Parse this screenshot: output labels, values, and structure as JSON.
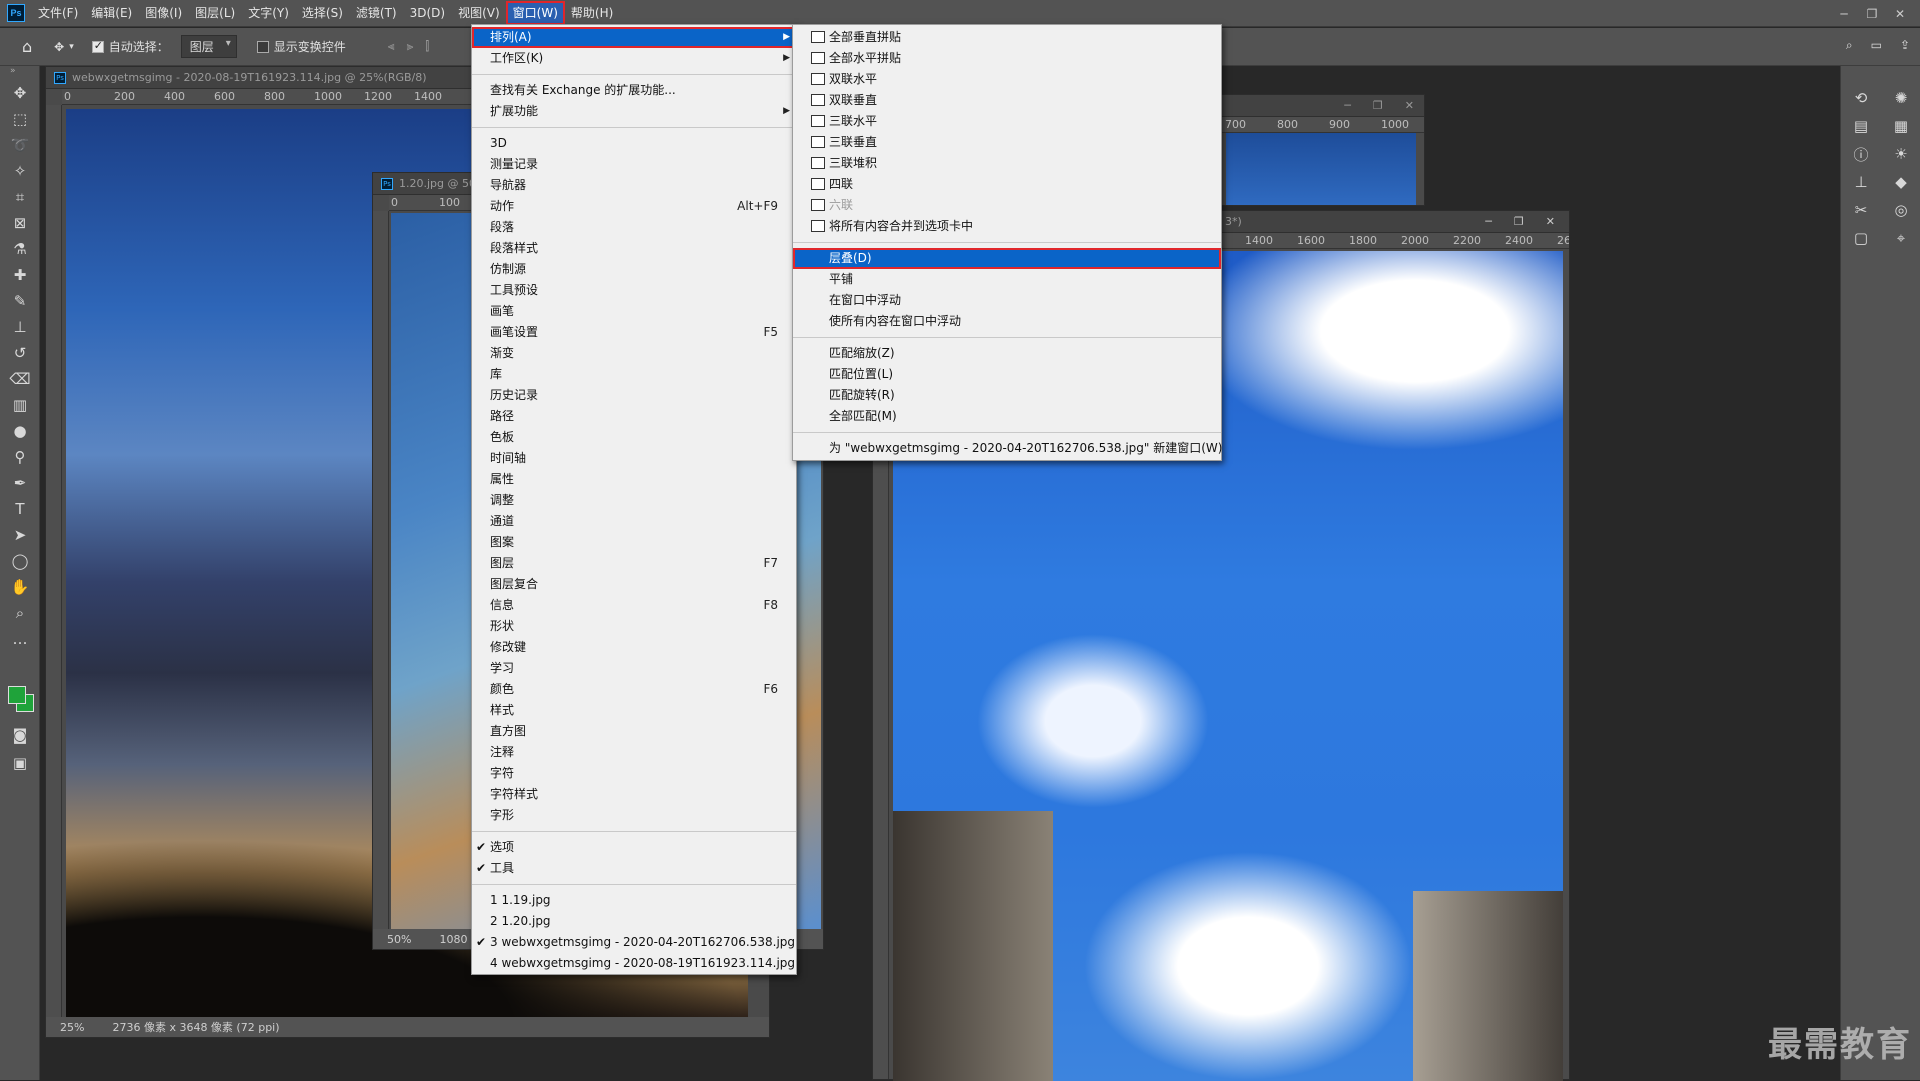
{
  "app": {
    "logo": "Ps"
  },
  "menubar": {
    "items": [
      "文件(F)",
      "编辑(E)",
      "图像(I)",
      "图层(L)",
      "文字(Y)",
      "选择(S)",
      "滤镜(T)",
      "3D(D)",
      "视图(V)",
      "窗口(W)",
      "帮助(H)"
    ],
    "active": "窗口(W)"
  },
  "window_controls": {
    "minimize": "─",
    "restore": "❐",
    "close": "✕"
  },
  "options_bar": {
    "auto_select_label": "自动选择：",
    "auto_select_checked": true,
    "layer_select_value": "图层",
    "show_transform_label": "显示变换控件",
    "show_transform_checked": false
  },
  "doc1": {
    "title": "webwxgetmsgimg - 2020-08-19T161923.114.jpg @ 25%(RGB/8)",
    "ruler_ticks": [
      "0",
      "200",
      "400",
      "600",
      "800",
      "1000",
      "1200",
      "1400"
    ],
    "zoom": "25%",
    "size_info": "2736 像素 x 3648 像素 (72 ppi)"
  },
  "doc2": {
    "title": "1.20.jpg @ 50",
    "ruler_ticks": [
      "0",
      "100"
    ],
    "zoom": "50%",
    "size_info": "1080 像"
  },
  "doc3": {
    "ruler_ticks": [
      "700",
      "800",
      "900",
      "1000"
    ]
  },
  "doc4": {
    "title_suffix": "3*)",
    "ruler_ticks": [
      "1400",
      "1600",
      "1800",
      "2000",
      "2200",
      "2400",
      "26"
    ]
  },
  "window_menu": {
    "items": [
      {
        "label": "排列(A)",
        "submenu": true,
        "highlighted": true
      },
      {
        "label": "工作区(K)",
        "submenu": true
      },
      {
        "sep": true
      },
      {
        "label": "查找有关 Exchange 的扩展功能..."
      },
      {
        "label": "扩展功能",
        "submenu": true
      },
      {
        "sep": true
      },
      {
        "label": "3D"
      },
      {
        "label": "测量记录"
      },
      {
        "label": "导航器"
      },
      {
        "label": "动作",
        "shortcut": "Alt+F9"
      },
      {
        "label": "段落"
      },
      {
        "label": "段落样式"
      },
      {
        "label": "仿制源"
      },
      {
        "label": "工具预设"
      },
      {
        "label": "画笔"
      },
      {
        "label": "画笔设置",
        "shortcut": "F5"
      },
      {
        "label": "渐变"
      },
      {
        "label": "库"
      },
      {
        "label": "历史记录"
      },
      {
        "label": "路径"
      },
      {
        "label": "色板"
      },
      {
        "label": "时间轴"
      },
      {
        "label": "属性"
      },
      {
        "label": "调整"
      },
      {
        "label": "通道"
      },
      {
        "label": "图案"
      },
      {
        "label": "图层",
        "shortcut": "F7"
      },
      {
        "label": "图层复合"
      },
      {
        "label": "信息",
        "shortcut": "F8"
      },
      {
        "label": "形状"
      },
      {
        "label": "修改键"
      },
      {
        "label": "学习"
      },
      {
        "label": "颜色",
        "shortcut": "F6"
      },
      {
        "label": "样式"
      },
      {
        "label": "直方图"
      },
      {
        "label": "注释"
      },
      {
        "label": "字符"
      },
      {
        "label": "字符样式"
      },
      {
        "label": "字形"
      },
      {
        "sep": true
      },
      {
        "label": "选项",
        "checked": true
      },
      {
        "label": "工具",
        "checked": true
      },
      {
        "sep": true
      },
      {
        "label": "1 1.19.jpg"
      },
      {
        "label": "2 1.20.jpg"
      },
      {
        "label": "3 webwxgetmsgimg - 2020-04-20T162706.538.jpg",
        "checked": true
      },
      {
        "label": "4 webwxgetmsgimg - 2020-08-19T161923.114.jpg"
      }
    ]
  },
  "arrange_menu": {
    "items": [
      {
        "label": "全部垂直拼贴",
        "icon": "tile-vertical-icon"
      },
      {
        "label": "全部水平拼贴",
        "icon": "tile-horizontal-icon"
      },
      {
        "label": "双联水平",
        "icon": "2up-horizontal-icon"
      },
      {
        "label": "双联垂直",
        "icon": "2up-vertical-icon"
      },
      {
        "label": "三联水平",
        "icon": "3up-horizontal-icon"
      },
      {
        "label": "三联垂直",
        "icon": "3up-vertical-icon"
      },
      {
        "label": "三联堆积",
        "icon": "3up-stacked-icon"
      },
      {
        "label": "四联",
        "icon": "4up-icon"
      },
      {
        "label": "六联",
        "icon": "6up-icon",
        "disabled": true
      },
      {
        "label": "将所有内容合并到选项卡中",
        "icon": "consolidate-tabs-icon"
      },
      {
        "sep": true
      },
      {
        "label": "层叠(D)",
        "highlighted": true
      },
      {
        "label": "平铺"
      },
      {
        "label": "在窗口中浮动"
      },
      {
        "label": "使所有内容在窗口中浮动"
      },
      {
        "sep": true
      },
      {
        "label": "匹配缩放(Z)"
      },
      {
        "label": "匹配位置(L)"
      },
      {
        "label": "匹配旋转(R)"
      },
      {
        "label": "全部匹配(M)"
      },
      {
        "sep": true
      },
      {
        "label": "为 \"webwxgetmsgimg - 2020-04-20T162706.538.jpg\" 新建窗口(W)"
      }
    ]
  },
  "tools": [
    "move-icon",
    "marquee-icon",
    "lasso-icon",
    "magic-wand-icon",
    "crop-icon",
    "frame-icon",
    "eyedropper-icon",
    "healing-icon",
    "brush-icon",
    "stamp-icon",
    "history-brush-icon",
    "eraser-icon",
    "gradient-icon",
    "blur-icon",
    "dodge-icon",
    "pen-icon",
    "type-icon",
    "path-select-icon",
    "ellipse-icon",
    "hand-icon",
    "zoom-icon",
    "more-icon"
  ],
  "colors": {
    "foreground": "#1fa33a",
    "background": "#1fa33a",
    "highlight": "#0a64c8",
    "annotation": "#e0262b"
  },
  "watermark": "最需教育"
}
